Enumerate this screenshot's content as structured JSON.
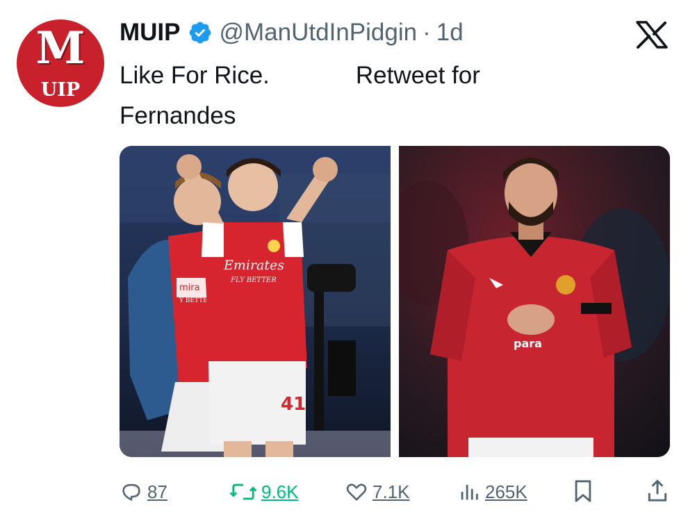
{
  "tweet": {
    "avatar": {
      "letter": "M",
      "text": "UIP",
      "color": "#c8212c"
    },
    "display_name": "MUIP",
    "verified_color": "#1d9bf0",
    "handle": "@ManUtdInPidgin",
    "separator": "·",
    "time": "1d",
    "text_part1": "Like For Rice.",
    "text_part2": "Retweet for",
    "text_line2": "Fernandes",
    "platform_icon": "x-logo-icon"
  },
  "media": {
    "left_image": {
      "jersey_sponsor": "Emirates",
      "jersey_sub": "FLY BETTER",
      "number": "41",
      "partial_sponsor": "mira",
      "partial_sub": "Y BETTE"
    },
    "right_image": {
      "sponsor": "para"
    }
  },
  "actions": {
    "replies": "87",
    "retweets": "9.6K",
    "likes": "7.1K",
    "views": "265K",
    "retweet_color": "#00ba7c",
    "icon_color": "#536471"
  }
}
